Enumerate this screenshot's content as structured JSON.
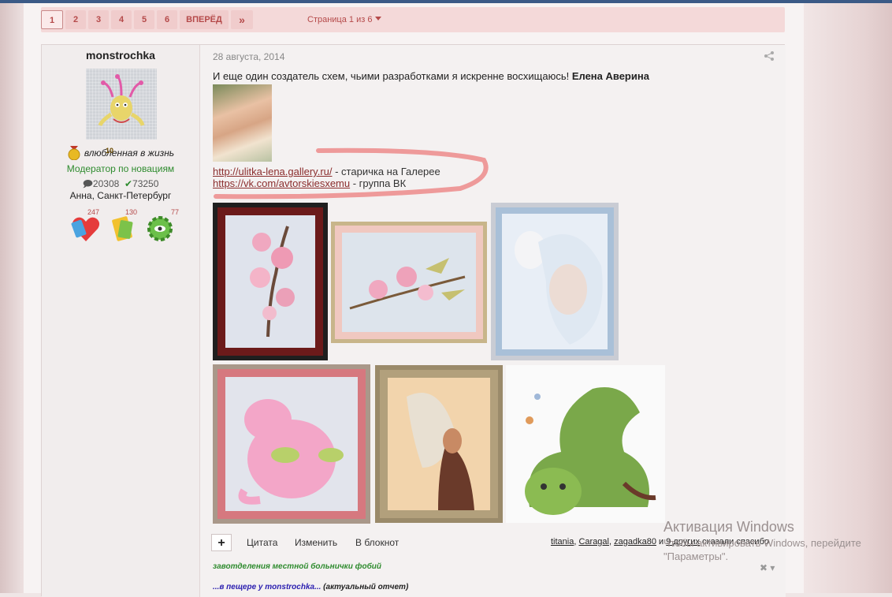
{
  "pagination": {
    "pages": [
      "1",
      "2",
      "3",
      "4",
      "5",
      "6"
    ],
    "next_label": "ВПЕРЁД",
    "last_label": "»",
    "info_label": "Страница 1 из 6"
  },
  "user": {
    "name": "monstrochka",
    "rank_number": "10",
    "rank_label": "влюбленная в жизнь",
    "group": "Модератор по новациям",
    "posts": "20308",
    "reputation": "73250",
    "location": "Анна, Санкт-Петербург",
    "awards": [
      {
        "icon": "heart-icon",
        "count": "247"
      },
      {
        "icon": "book-icon",
        "count": "130"
      },
      {
        "icon": "gear-icon",
        "count": "77"
      }
    ]
  },
  "post": {
    "date": "28 августа, 2014",
    "text_before": "И еще один создатель схем, чьими разработками я искренне восхищаюсь! ",
    "text_bold": "Елена Аверина",
    "link1": "http://ulitka-lena.gallery.ru/",
    "link1_suffix": " - старичка на Галерее",
    "link2": "https://vk.com/avtorskiesxemu",
    "link2_suffix": " - группа ВК"
  },
  "actions": {
    "plus": "+",
    "quote": "Цитата",
    "edit": "Изменить",
    "notepad": "В блокнот"
  },
  "thanks": {
    "users": [
      "titania",
      "Caragal",
      "zagadka80"
    ],
    "sep": ", ",
    "and_word": " и ",
    "others": "9 других",
    "suffix": " сказали спасибо"
  },
  "signature": {
    "line1": "завотделения местной больнички фобий",
    "line2_link": "...в пещере у monstrochka...",
    "line2_rest": " (актуальный отчет)",
    "close": "✖ ▾"
  },
  "windows": {
    "title": "Активация Windows",
    "line1": "Чтобы активировать Windows, перейдите",
    "line2": "\"Параметры\"."
  },
  "colors": {
    "accent": "#b54a4a",
    "link": "#8b2d2d",
    "moderator": "#2e8b2e",
    "marker": "#ee9a9a"
  }
}
